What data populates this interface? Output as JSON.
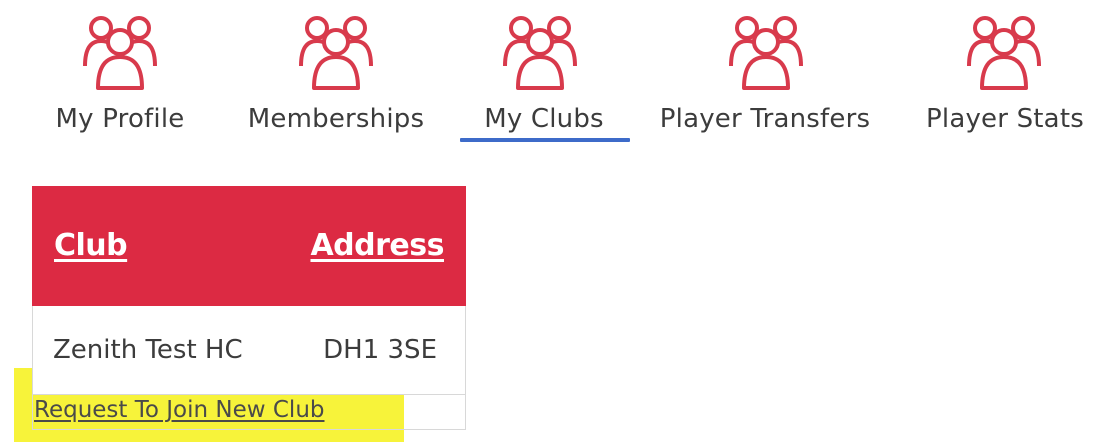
{
  "nav": {
    "tabs": [
      {
        "label": "My Profile",
        "icon": "group-icon",
        "active": false
      },
      {
        "label": "Memberships",
        "icon": "group-icon",
        "active": false
      },
      {
        "label": "My Clubs",
        "icon": "group-icon",
        "active": true
      },
      {
        "label": "Player Transfers",
        "icon": "group-icon",
        "active": false
      },
      {
        "label": "Player Stats",
        "icon": "group-icon",
        "active": false
      }
    ],
    "icon_color": "#d83a4c",
    "active_underline_color": "#3d6bc9"
  },
  "clubs_table": {
    "header_color": "#dc2a43",
    "columns": [
      "Club",
      "Address"
    ],
    "rows": [
      {
        "club": "Zenith Test HC",
        "address": "DH1 3SE"
      }
    ]
  },
  "actions": {
    "request_join_label": "Request To Join New Club",
    "highlight_color": "#f7f33a"
  }
}
